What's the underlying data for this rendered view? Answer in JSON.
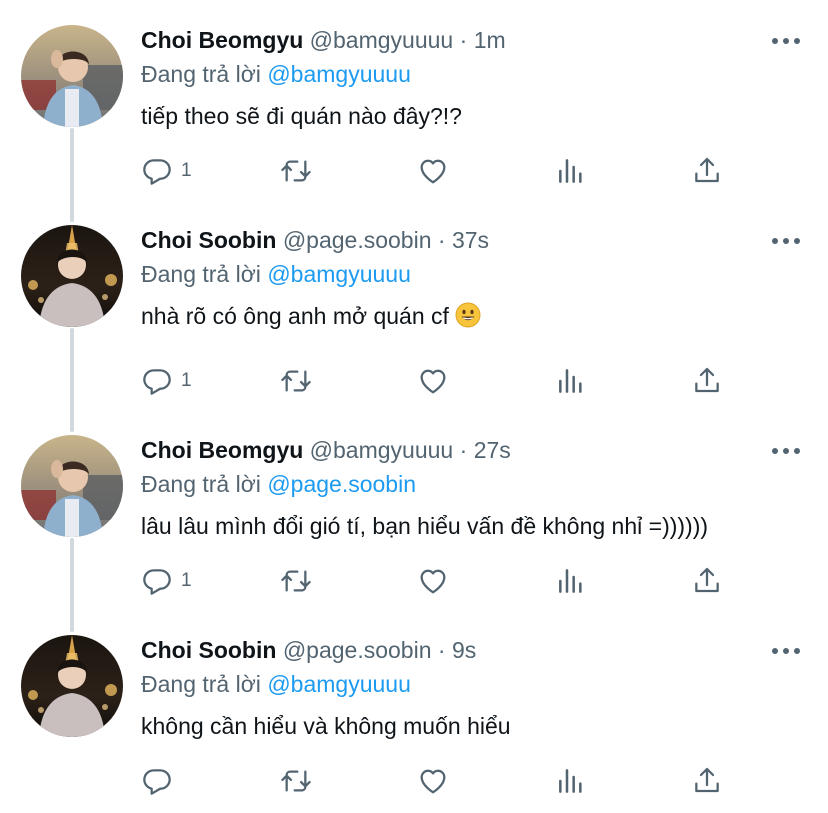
{
  "colors": {
    "text": "#0f1419",
    "secondary": "#536471",
    "link": "#1d9bf0",
    "thread_line": "#cfd9de"
  },
  "tweets": [
    {
      "name": "Choi Beomgyu",
      "handle": "@bamgyuuuu",
      "dot": "·",
      "time": "1m",
      "reply_prefix": "Đang trả lời",
      "reply_to": "@bamgyuuuu",
      "text": "tiếp theo sẽ đi quán nào đây?!?",
      "reply_count": "1",
      "avatar": "avatar-beomgyu"
    },
    {
      "name": "Choi Soobin",
      "handle": "@page.soobin",
      "dot": "·",
      "time": "37s",
      "reply_prefix": "Đang trả lời",
      "reply_to": "@bamgyuuuu",
      "text": "nhà rõ có ông anh mở quán cf",
      "emoji": "grinning-face-emoji",
      "reply_count": "1",
      "avatar": "avatar-soobin"
    },
    {
      "name": "Choi Beomgyu",
      "handle": "@bamgyuuuu",
      "dot": "·",
      "time": "27s",
      "reply_prefix": "Đang trả lời",
      "reply_to": "@page.soobin",
      "text": "lâu lâu mình đổi gió tí, bạn hiểu vấn đề không nhỉ =))))))",
      "reply_count": "1",
      "avatar": "avatar-beomgyu"
    },
    {
      "name": "Choi Soobin",
      "handle": "@page.soobin",
      "dot": "·",
      "time": "9s",
      "reply_prefix": "Đang trả lời",
      "reply_to": "@bamgyuuuu",
      "text": "không cần hiểu và không muốn hiểu",
      "reply_count": "",
      "avatar": "avatar-soobin"
    }
  ],
  "icons": [
    "reply-icon",
    "retweet-icon",
    "like-icon",
    "views-icon",
    "share-icon",
    "more-icon"
  ]
}
